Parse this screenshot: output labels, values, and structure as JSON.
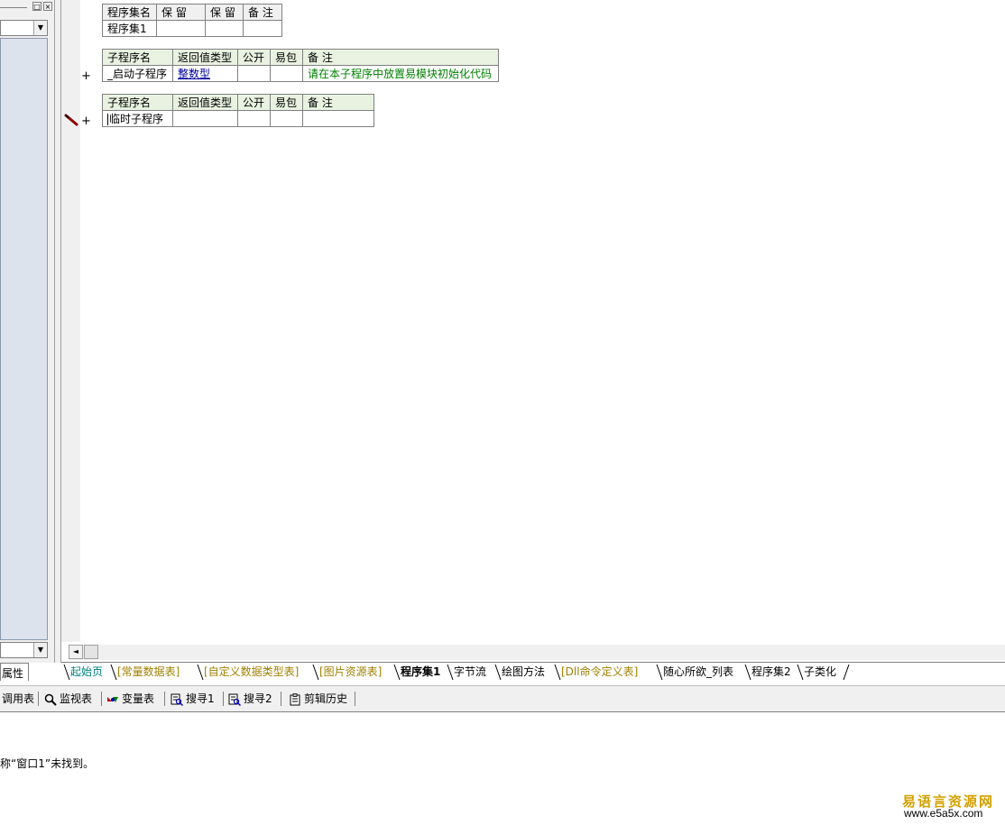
{
  "program_set_table": {
    "headers": [
      "程序集名",
      "保 留",
      "保 留",
      "备 注"
    ],
    "row": [
      "程序集1",
      "",
      "",
      ""
    ]
  },
  "subroutine_tables": [
    {
      "headers": [
        "子程序名",
        "返回值类型",
        "公开",
        "易包",
        "备 注"
      ],
      "row": [
        "_启动子程序",
        "整数型",
        "",
        "",
        "请在本子程序中放置易模块初始化代码"
      ]
    },
    {
      "headers": [
        "子程序名",
        "返回值类型",
        "公开",
        "易包",
        "备 注"
      ],
      "row": [
        "临时子程序",
        "",
        "",
        "",
        ""
      ]
    }
  ],
  "gutter": {
    "expand_symbol": "+"
  },
  "left_panel": {
    "tab_label": "属性"
  },
  "editor_tabs": [
    {
      "label": "起始页"
    },
    {
      "label": "[常量数据表]"
    },
    {
      "label": "[自定义数据类型表]"
    },
    {
      "label": "[图片资源表]"
    },
    {
      "label": "程序集1",
      "active": true
    },
    {
      "label": "字节流"
    },
    {
      "label": "绘图方法"
    },
    {
      "label": "[Dll命令定义表]"
    },
    {
      "label": "随心所欲_列表"
    },
    {
      "label": "程序集2"
    },
    {
      "label": "子类化"
    }
  ],
  "toolbar": {
    "items": [
      "调用表",
      "监视表",
      "变量表",
      "搜寻1",
      "搜寻2",
      "剪辑历史"
    ]
  },
  "output": {
    "message": "称“窗口1”未找到。"
  },
  "watermark": {
    "cn": "易语言资源网",
    "en": "www.e5a5x.com"
  },
  "colors": {
    "tree_bg": "#dce3ec",
    "header_green": "#e9f2e1",
    "link_blue": "#0000a0",
    "comment_green": "#008000",
    "watermark": "#d4a000"
  }
}
